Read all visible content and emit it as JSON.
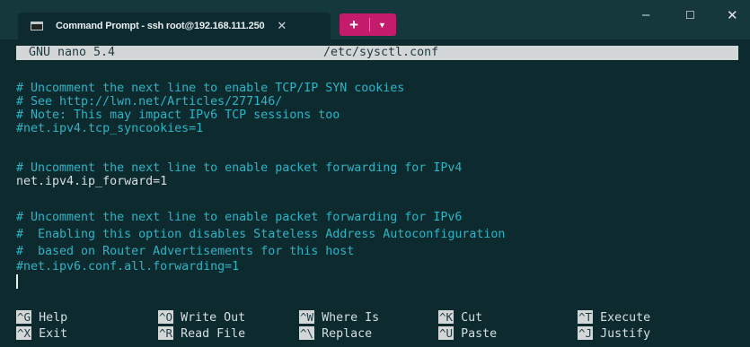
{
  "window": {
    "tab_title": "Command Prompt - ssh  root@192.168.111.250",
    "tab_close": "✕",
    "new_tab": "+",
    "dropdown": "⌄",
    "minimize": "–",
    "maximize": "☐",
    "close": "✕"
  },
  "nano": {
    "version": "GNU nano 5.4",
    "filename": "/etc/sysctl.conf",
    "lines": [
      {
        "text": "# Uncomment the next line to enable TCP/IP SYN cookies",
        "type": "comment"
      },
      {
        "text": "# See http://lwn.net/Articles/277146/",
        "type": "comment"
      },
      {
        "text": "# Note: This may impact IPv6 TCP sessions too",
        "type": "comment"
      },
      {
        "text": "#net.ipv4.tcp_syncookies=1",
        "type": "comment"
      },
      {
        "text": "",
        "type": "blank"
      },
      {
        "text": "# Uncomment the next line to enable packet forwarding for IPv4",
        "type": "comment"
      },
      {
        "text": "net.ipv4.ip_forward=1",
        "type": "plain"
      },
      {
        "text": "",
        "type": "blank"
      },
      {
        "text": "# Uncomment the next line to enable packet forwarding for IPv6",
        "type": "comment"
      },
      {
        "text": "#  Enabling this option disables Stateless Address Autoconfiguration",
        "type": "comment"
      },
      {
        "text": "#  based on Router Advertisements for this host",
        "type": "comment"
      },
      {
        "text": "#net.ipv6.conf.all.forwarding=1",
        "type": "comment"
      }
    ],
    "shortcuts": [
      {
        "key": "^G",
        "label": "Help"
      },
      {
        "key": "^X",
        "label": "Exit"
      },
      {
        "key": "^O",
        "label": "Write Out"
      },
      {
        "key": "^R",
        "label": "Read File"
      },
      {
        "key": "^W",
        "label": "Where Is"
      },
      {
        "key": "^\\",
        "label": "Replace"
      },
      {
        "key": "^K",
        "label": "Cut"
      },
      {
        "key": "^U",
        "label": "Paste"
      },
      {
        "key": "^T",
        "label": "Execute"
      },
      {
        "key": "^J",
        "label": "Justify"
      }
    ]
  },
  "colors": {
    "background": "#0d2a2f",
    "comment": "#2fb3c3",
    "header_bg": "#d4d7d8",
    "new_tab_accent": "#c51b6d"
  }
}
